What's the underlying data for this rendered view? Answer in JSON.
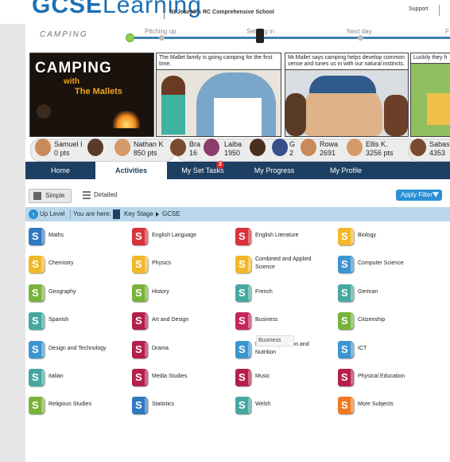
{
  "header": {
    "logo_bold": "GCSE",
    "logo_light": "Learning",
    "school": "St Joseph's RC Comprehensive School",
    "support": "Support"
  },
  "progress": {
    "title": "CAMPING",
    "stages": [
      "Pitching up",
      "Settling in",
      "Next day",
      "F"
    ]
  },
  "comic": {
    "panel1": {
      "title": "CAMPING",
      "with": "with",
      "mallets": "The Mallets"
    },
    "panel2": {
      "caption": "The Mallet family is going camping for the first time."
    },
    "panel3": {
      "caption": "Mr.Mallet says camping helps develop common sense and tunes us in with our natural instincts."
    },
    "panel4": {
      "caption": "Luckily they fi"
    }
  },
  "leaderboard": [
    {
      "name": "Samuel I",
      "pts": "0 pts"
    },
    {
      "name": "Nathan K",
      "pts": "850 pts"
    },
    {
      "name": "Bra",
      "pts": "16"
    },
    {
      "name": "Laiba",
      "pts": "1950"
    },
    {
      "name": "G",
      "pts": "2"
    },
    {
      "name": "Rowa",
      "pts": "2691"
    },
    {
      "name": "Ellis K.",
      "pts": "3256 pts"
    },
    {
      "name": "Sabas",
      "pts": "4353"
    }
  ],
  "nav": {
    "items": [
      "Home",
      "Activities",
      "My Set Tasks",
      "My Progress",
      "My Profile"
    ],
    "active": "Activities",
    "set_tasks_badge": "2"
  },
  "view": {
    "simple": "Simple",
    "detailed": "Detailed",
    "apply_filter": "Apply Filter"
  },
  "breadcrumb": {
    "up": "Up Level",
    "you_are_here": "You are here:",
    "key_stage": "Key Stage",
    "current": "GCSE"
  },
  "subjects": [
    {
      "label": "Maths",
      "color": "#2f79c1"
    },
    {
      "label": "English Language",
      "color": "#d8323a"
    },
    {
      "label": "English Literature",
      "color": "#d8323a"
    },
    {
      "label": "Biology",
      "color": "#f3b829"
    },
    {
      "label": "Chemistry",
      "color": "#f3b829"
    },
    {
      "label": "Physics",
      "color": "#f3b829"
    },
    {
      "label": "Combined and Applied Science",
      "color": "#f3b829"
    },
    {
      "label": "Computer Science",
      "color": "#3b95cf"
    },
    {
      "label": "Geography",
      "color": "#78b33a"
    },
    {
      "label": "History",
      "color": "#78b33a"
    },
    {
      "label": "French",
      "color": "#46a7a0"
    },
    {
      "label": "German",
      "color": "#46a7a0"
    },
    {
      "label": "Spanish",
      "color": "#46a7a0"
    },
    {
      "label": "Art and Design",
      "color": "#b51f4c"
    },
    {
      "label": "Business",
      "color": "#c4275a"
    },
    {
      "label": "Citizenship",
      "color": "#78b33a"
    },
    {
      "label": "Design and Technology",
      "color": "#3b95cf"
    },
    {
      "label": "Drama",
      "color": "#b51f4c"
    },
    {
      "label": "Food Preparation and Nutrition",
      "color": "#3b95cf"
    },
    {
      "label": "ICT",
      "color": "#3b95cf"
    },
    {
      "label": "Italian",
      "color": "#46a7a0"
    },
    {
      "label": "Media Studies",
      "color": "#b51f4c"
    },
    {
      "label": "Music",
      "color": "#b51f4c"
    },
    {
      "label": "Physical Education",
      "color": "#b51f4c"
    },
    {
      "label": "Religious Studies",
      "color": "#78b33a"
    },
    {
      "label": "Statistics",
      "color": "#2f79c1"
    },
    {
      "label": "Welsh",
      "color": "#46a7a0"
    },
    {
      "label": "More Subjects",
      "color": "#f07a22"
    }
  ],
  "subject_icon_letter": "S",
  "tooltip": "Business"
}
